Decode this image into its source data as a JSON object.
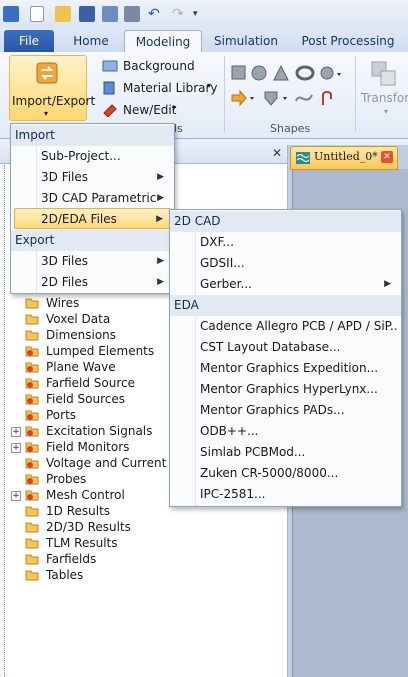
{
  "tabs": [
    {
      "label": "File"
    },
    {
      "label": "Home"
    },
    {
      "label": "Modeling"
    },
    {
      "label": "Simulation"
    },
    {
      "label": "Post Processing"
    }
  ],
  "ribbon": {
    "import_export_label": "Import/Export",
    "background_label": "Background",
    "material_library_label": "Material Library",
    "new_edit_label": "New/Edit",
    "group_partial_label": "ls",
    "shapes_group_label": "Shapes",
    "transform_label": "Transform"
  },
  "doc_tab": {
    "title": "Untitled_0*"
  },
  "import_menu": {
    "import_header": "Import",
    "import_items": [
      {
        "label": "Sub-Project...",
        "submenu": false
      },
      {
        "label": "3D Files",
        "submenu": true
      },
      {
        "label": "3D CAD Parametric",
        "submenu": true
      },
      {
        "label": "2D/EDA Files",
        "submenu": true,
        "highlighted": true
      }
    ],
    "export_header": "Export",
    "export_items": [
      {
        "label": "3D Files",
        "submenu": true
      },
      {
        "label": "2D Files",
        "submenu": true
      }
    ]
  },
  "eda_submenu": {
    "cad_header": "2D CAD",
    "cad_items": [
      {
        "label": "DXF...",
        "submenu": false
      },
      {
        "label": "GDSII...",
        "submenu": false
      },
      {
        "label": "Gerber...",
        "submenu": true
      }
    ],
    "eda_header": "EDA",
    "eda_items": [
      {
        "label": "Cadence Allegro PCB / APD / SiP..."
      },
      {
        "label": "CST Layout Database..."
      },
      {
        "label": "Mentor Graphics Expedition..."
      },
      {
        "label": "Mentor Graphics HyperLynx..."
      },
      {
        "label": "Mentor Graphics PADs..."
      },
      {
        "label": "ODB++..."
      },
      {
        "label": "Simlab PCBMod..."
      },
      {
        "label": "Zuken CR-5000/8000..."
      },
      {
        "label": "IPC-2581..."
      }
    ]
  },
  "tree": {
    "items": [
      {
        "label": "Wires",
        "expander": false,
        "icon": "folder-icon"
      },
      {
        "label": "Voxel Data",
        "expander": false,
        "icon": "folder-icon"
      },
      {
        "label": "Dimensions",
        "expander": false,
        "icon": "folder-icon"
      },
      {
        "label": "Lumped Elements",
        "expander": false,
        "icon": "gear-folder-icon"
      },
      {
        "label": "Plane Wave",
        "expander": false,
        "icon": "gear-folder-icon"
      },
      {
        "label": "Farfield Source",
        "expander": false,
        "icon": "gear-folder-icon"
      },
      {
        "label": "Field Sources",
        "expander": false,
        "icon": "gear-folder-icon"
      },
      {
        "label": "Ports",
        "expander": false,
        "icon": "gear-folder-icon"
      },
      {
        "label": "Excitation Signals",
        "expander": true,
        "icon": "gear-folder-icon"
      },
      {
        "label": "Field Monitors",
        "expander": true,
        "icon": "gear-folder-icon"
      },
      {
        "label": "Voltage and Current M",
        "expander": false,
        "icon": "gear-folder-icon"
      },
      {
        "label": "Probes",
        "expander": false,
        "icon": "gear-folder-icon"
      },
      {
        "label": "Mesh Control",
        "expander": true,
        "icon": "gear-folder-icon"
      },
      {
        "label": "1D Results",
        "expander": false,
        "icon": "folder-icon"
      },
      {
        "label": "2D/3D Results",
        "expander": false,
        "icon": "folder-icon"
      },
      {
        "label": "TLM Results",
        "expander": false,
        "icon": "folder-icon"
      },
      {
        "label": "Farfields",
        "expander": false,
        "icon": "folder-icon"
      },
      {
        "label": "Tables",
        "expander": false,
        "icon": "folder-icon"
      }
    ]
  },
  "colors": {
    "menu_highlight": "#ffd878",
    "file_tab": "#2a56a4",
    "folder": "#f2c55a",
    "gear": "#d6452b"
  }
}
